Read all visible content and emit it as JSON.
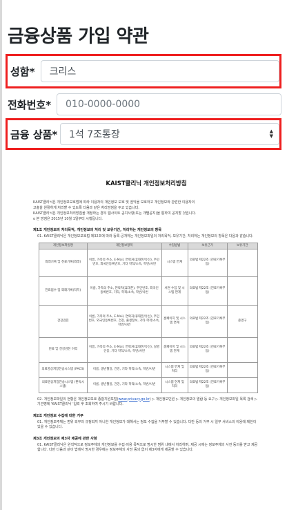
{
  "page": {
    "title": "금융상품 가입 약관"
  },
  "form": {
    "name": {
      "label": "성함*",
      "value": "크리스"
    },
    "phone": {
      "label": "전화번호*",
      "placeholder": "010-0000-0000"
    },
    "product": {
      "label": "금융 상품*",
      "selected": "1석 7조통장"
    }
  },
  "document": {
    "title": "KAIST클리닉 개인정보처리방침",
    "intro": [
      "KAIST클리닉은 개인정보보호법에 따라 이용자의 개인정보 보호 및 권익을 보호하고 개인정보와 관련한 이용자의",
      "고충을 원활하게 처리할 수 있도록 다음과 같은 처리방침을 두고 있습니다.",
      "KAIST클리닉은 개인정보처리방침을 개정하는 경우 웹사이트 공지사항(또는 개별공지)을 통하여 공지할 것입니다.",
      "о 본 방침은 2015년 10월 1일부터 시행됩니다."
    ],
    "sections": [
      {
        "heading": "제1조 개인정보의 처리목적, 개인정보의 처리 및 보유기간, 처리하는 개인정보의 항목",
        "text": "01. KAIST클리닉은 개인정보보호법 제32조에 따라 등록·공개하는 개인정보파일의 처리목적, 보유기간, 처리하는 개인정보의 항목은 다음과 같습니다."
      }
    ],
    "table": {
      "headers": [
        "개인정보파일명",
        "개인정보항목",
        "수집방법",
        "보유근거",
        "보유기간"
      ],
      "rows": [
        [
          "외래기록 및 진료기록(외래)",
          "이름, 가족의 주소, E-Mail, 연락처(휴대폰/유선), 주민번호, 외국인등록번호, 기타 학적/소속, 학번/사번",
          "시스템 연계",
          "의료법 제22조 (진료기록부 등)",
          ""
        ],
        [
          "진료접수 및 외래기록(처치)",
          "이름, 가족의 주소, 연락처(휴대폰), 주민번호, 외국인등록번호, 기타, 학적/소속, 학번/사번",
          "서면 수집 및 시스템 연계",
          "의료법 제22조 (진료기록부 등)",
          ""
        ],
        [
          "건강검진",
          "이름, 가족의 주소, E-Mail, 연락처(휴대폰/유선), 주민번호, 외국인등록번호, 건강, 출생정보, 기타 학적/소속, 학번/사번",
          "홈페이지 및 시스템 연계",
          "의료법 제22조 (진료기록부 등)",
          "준영구"
        ],
        [
          "진료 및 건강검진 이력",
          "이름, 가족의 주소, E-Mail, 연락처(휴대폰/유선), 실명인증, 기타 학적/소속, 학번/사번",
          "홈페이지 및 시스템 연계",
          "의료법 제22조 (진료기록부 등)",
          ""
        ],
        [
          "의료영상저장전송시스템 (PACS)",
          "이름, 생년월일, 건강, 기타 학적/소속, 학번/사번",
          "시스템 연계 및 처리",
          "의료법 제22조 (진료기록부 등)",
          ""
        ],
        [
          "의료영상저장전송시스템 (판독시스템)",
          "이름, 생년월일, 건강, 기타 학적/소속, 학번/사번",
          "시스템 연계 및 처리",
          "의료법 제22조 (진료기록부 등)",
          ""
        ]
      ]
    },
    "note": {
      "prefix": "02. 개인정보파일의 현황은 개인정보보호 종합지원포털(",
      "link": "www.privacy.go.kr",
      "suffix": ") ▷ 개인정보민원 ▷ 개인정보의 열람 등 요구 ▷ 개인정보파일 목록 검색 ▷ 기관명에 'KAIST클리닉' 입력 후 조회하여 주시기 바랍니다."
    },
    "sections2": [
      {
        "heading": "제2조 개인정보 수집에 대한 거부",
        "text": "01. 개인정보주체는 범위 외부의 규정되지 아니한 개인정보가 대해서는 정보 수집을 거부할 수 있습니다. 다만 동의 거부 시 일부 서비스의 이용에 제한이 있을 수 있습니다."
      },
      {
        "heading": "제3조 개인정보의 제3자 제공에 관한 사항",
        "text": "01. KAIST클리닉은 원칙적으로 정보주체의 개인정보를 수집·이용 목적으로 명시한 범위 내에서 처리하며, 제공 시에는 정보주체의 사전 동의를 받고 제공합니다. 다만 다음과 같이 법에서 명시한 경우에는 정보주체의 사전 동의 없이 제3자에게 제공할 수 있습니다."
      }
    ]
  }
}
